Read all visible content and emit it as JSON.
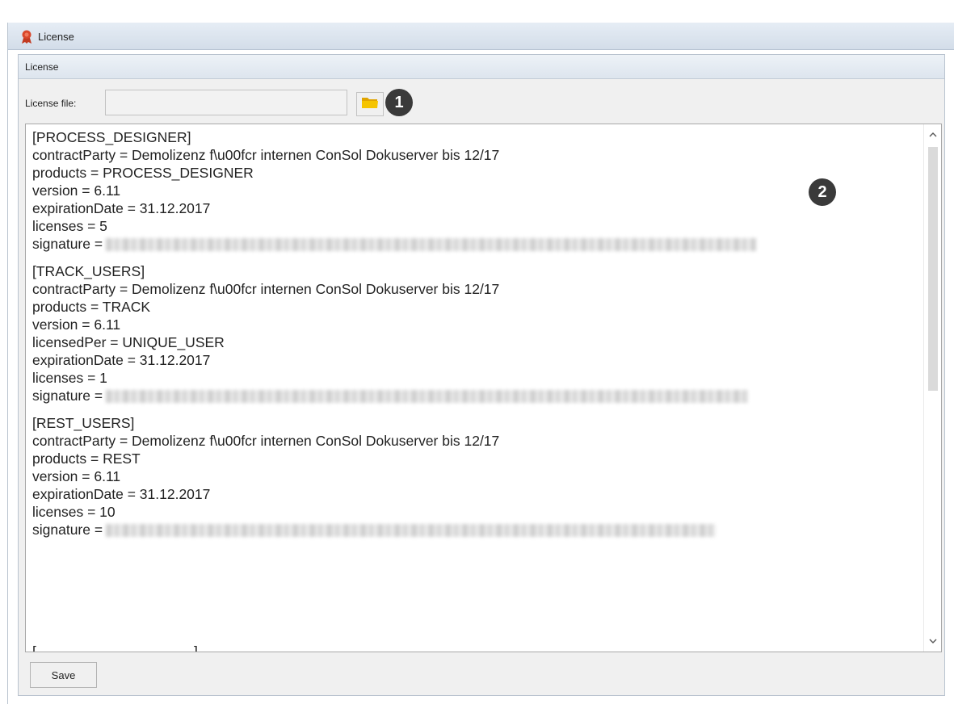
{
  "window": {
    "title": "License",
    "icon": "license-seal-icon"
  },
  "panel": {
    "header": "License",
    "license_file_label": "License file:",
    "license_file_value": "",
    "browse_icon": "folder-icon",
    "save_label": "Save"
  },
  "markers": [
    "1",
    "2"
  ],
  "license_text": {
    "block1": {
      "section": "[PROCESS_DESIGNER]",
      "contract": "contractParty = Demolizenz f\\u00fcr internen ConSol Dokuserver bis 12/17",
      "products": "products = PROCESS_DESIGNER",
      "version": "version = 6.11",
      "expiration": "expirationDate = 31.12.2017",
      "licenses": "licenses = 5",
      "signature_label": "signature ="
    },
    "block2": {
      "section": "[TRACK_USERS]",
      "contract": "contractParty = Demolizenz f\\u00fcr internen ConSol Dokuserver bis 12/17",
      "products": "products = TRACK",
      "version": "version = 6.11",
      "licensed_per": "licensedPer = UNIQUE_USER",
      "expiration": "expirationDate = 31.12.2017",
      "licenses": "licenses = 1",
      "signature_label": "signature ="
    },
    "block3": {
      "section": "[REST_USERS]",
      "contract": "contractParty = Demolizenz f\\u00fcr internen ConSol Dokuserver bis 12/17",
      "products": "products = REST",
      "version": "version = 6.11",
      "expiration": "expirationDate = 31.12.2017",
      "licenses": "licenses = 10",
      "signature_label": "signature ="
    }
  },
  "colors": {
    "marker_bg": "#3a3a3a",
    "folder": "#f5b800",
    "title_icon": "#d9472b"
  }
}
